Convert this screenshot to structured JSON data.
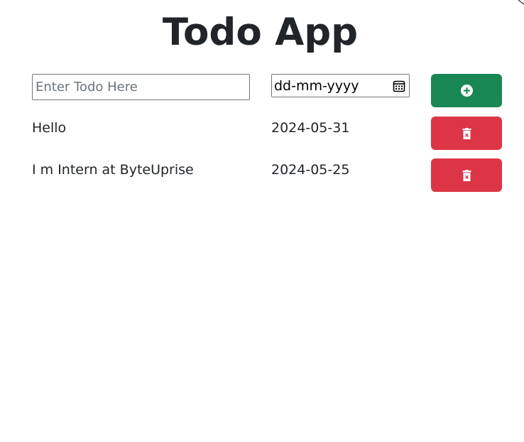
{
  "app": {
    "title": "Todo App"
  },
  "form": {
    "todo_placeholder": "Enter Todo Here",
    "date_display": "dd-mm-yyyy",
    "add_icon": "plus-circle-icon"
  },
  "todos": [
    {
      "name": "Hello",
      "date": "2024-05-31",
      "delete_icon": "trash-icon"
    },
    {
      "name": "I m Intern at ByteUprise",
      "date": "2024-05-25",
      "delete_icon": "trash-icon"
    }
  ],
  "colors": {
    "add_button": "#198754",
    "delete_button": "#dc3545",
    "text": "#212529"
  }
}
